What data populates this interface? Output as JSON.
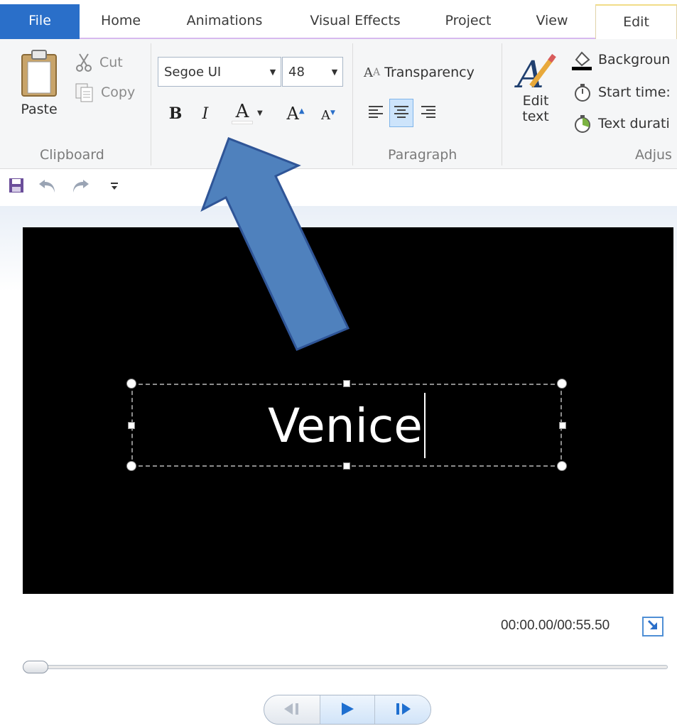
{
  "tabs": [
    "File",
    "Home",
    "Animations",
    "Visual Effects",
    "Project",
    "View",
    "Edit"
  ],
  "clipboard": {
    "paste": "Paste",
    "cut": "Cut",
    "copy": "Copy",
    "group_label": "Clipboard"
  },
  "font": {
    "family": "Segoe UI",
    "size": "48"
  },
  "paragraph": {
    "transparency": "Transparency",
    "group_label": "Paragraph"
  },
  "adjust": {
    "edit_text_line1": "Edit",
    "edit_text_line2": "text",
    "background": "Backgroun",
    "start_time": "Start time:",
    "text_duration": "Text durati",
    "group_label": "Adjus"
  },
  "preview": {
    "caption_text": "Venice"
  },
  "playback": {
    "time": "00:00.00/00:55.50"
  },
  "colors": {
    "file_tab": "#2a6fc9",
    "annotation_arrow": "#4f81bd",
    "annotation_arrow_border": "#2f5597"
  }
}
